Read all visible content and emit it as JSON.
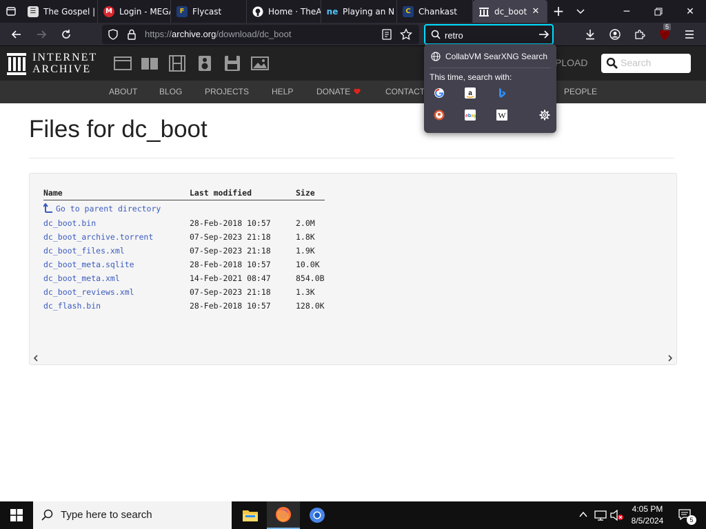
{
  "browser": {
    "tabs": [
      {
        "title": "The Gospel | E",
        "favicon": "gospel-icon"
      },
      {
        "title": "Login - MEGA",
        "favicon": "mega-icon"
      },
      {
        "title": "Flycast",
        "favicon": "flycast-icon"
      },
      {
        "title": "Home · TheA",
        "favicon": "github-icon"
      },
      {
        "title": "Playing an N",
        "favicon": "ne-icon"
      },
      {
        "title": "Chankast",
        "favicon": "chankast-icon"
      },
      {
        "title": "dc_boot d",
        "favicon": "archive-icon",
        "active": true
      }
    ],
    "url_scheme": "https://",
    "url_host": "archive.org",
    "url_path": "/download/dc_boot",
    "search_value": "retro",
    "extension_badge": "5"
  },
  "search_popup": {
    "suggestion": "CollabVM SearXNG Search",
    "with_label": "This time, search with:",
    "engines": [
      "google-icon",
      "amazon-icon",
      "bing-icon",
      "duckduckgo-icon",
      "ebay-icon",
      "wikipedia-icon",
      "settings-gear-icon"
    ]
  },
  "ia": {
    "logo_line1": "INTERNET",
    "logo_line2": "ARCHIVE",
    "upload_label": "PLOAD",
    "search_placeholder": "Search",
    "nav": [
      "ABOUT",
      "BLOG",
      "PROJECTS",
      "HELP",
      "DONATE",
      "CONTACT",
      "PEOPLE"
    ]
  },
  "page": {
    "title": "Files for dc_boot",
    "columns": [
      "Name",
      "Last modified",
      "Size"
    ],
    "parent_link": "Go to parent directory",
    "files": [
      {
        "name": "dc_boot.bin",
        "modified": "28-Feb-2018 10:57",
        "size": "2.0M"
      },
      {
        "name": "dc_boot_archive.torrent",
        "modified": "07-Sep-2023 21:18",
        "size": "1.8K"
      },
      {
        "name": "dc_boot_files.xml",
        "modified": "07-Sep-2023 21:18",
        "size": "1.9K"
      },
      {
        "name": "dc_boot_meta.sqlite",
        "modified": "28-Feb-2018 10:57",
        "size": "10.0K"
      },
      {
        "name": "dc_boot_meta.xml",
        "modified": "14-Feb-2021 08:47",
        "size": "854.0B"
      },
      {
        "name": "dc_boot_reviews.xml",
        "modified": "07-Sep-2023 21:18",
        "size": "1.3K"
      },
      {
        "name": "dc_flash.bin",
        "modified": "28-Feb-2018 10:57",
        "size": "128.0K"
      }
    ]
  },
  "taskbar": {
    "search_placeholder": "Type here to search",
    "time": "4:05 PM",
    "date": "8/5/2024",
    "notification_count": "5"
  }
}
